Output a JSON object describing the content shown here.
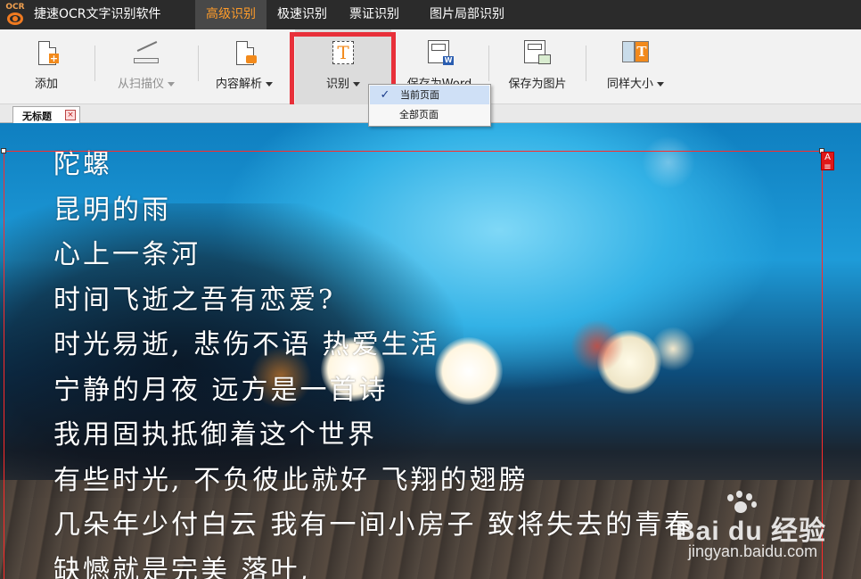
{
  "app": {
    "logo_text": "OCR",
    "title": "捷速OCR文字识别软件"
  },
  "menu_tabs": [
    {
      "label": "高级识别",
      "active": true
    },
    {
      "label": "极速识别",
      "active": false
    },
    {
      "label": "票证识别",
      "active": false
    },
    {
      "label": "图片局部识别",
      "active": false
    }
  ],
  "toolbar": {
    "add": "添加",
    "from_scanner": "从扫描仪",
    "content_parse": "内容解析",
    "recognize": "识别",
    "save_word": "保存为Word",
    "save_image": "保存为图片",
    "same_size": "同样大小"
  },
  "recognize_menu": {
    "items": [
      {
        "label": "当前页面",
        "checked": true
      },
      {
        "label": "全部页面",
        "checked": false
      }
    ],
    "check_glyph": "✓"
  },
  "document_tab": {
    "title": "无标题",
    "close_glyph": "×"
  },
  "canvas": {
    "marker_label": "A",
    "poem_lines": [
      "陀螺",
      "昆明的雨",
      "心上一条河",
      "时间飞逝之吾有恋爱?",
      "时光易逝, 悲伤不语 热爱生活",
      "宁静的月夜 远方是一首诗",
      "我用固执抵御着这个世界",
      "有些时光, 不负彼此就好 飞翔的翅膀",
      "几朵年少付白云 我有一间小房子 致将失去的青春",
      "缺憾就是完美 落叶,"
    ]
  },
  "watermark": {
    "brand": "Bai du 经验",
    "url": "jingyan.baidu.com"
  },
  "colors": {
    "titlebar": "#2b2b2b",
    "active_tab_text": "#ff9c2a",
    "highlight_red": "#e8303a",
    "selection_red": "#ff2a2a"
  }
}
